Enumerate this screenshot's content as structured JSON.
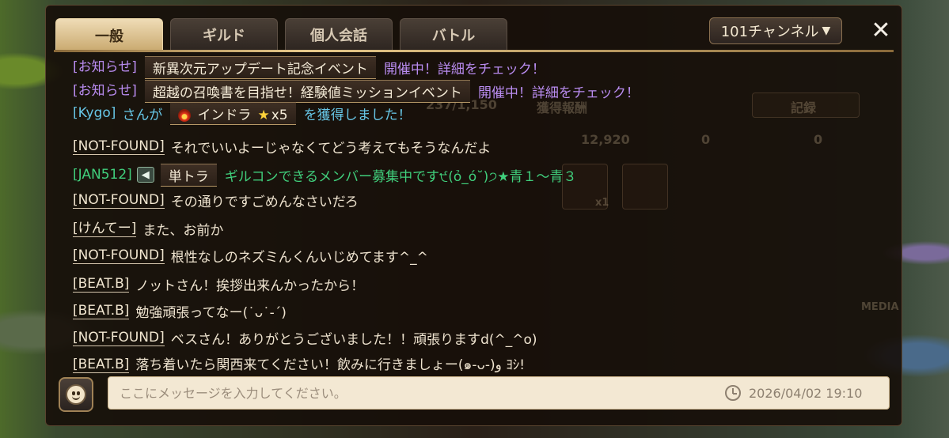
{
  "tabs": [
    {
      "label": "一般",
      "active": true
    },
    {
      "label": "ギルド",
      "active": false
    },
    {
      "label": "個人会話",
      "active": false
    },
    {
      "label": "バトル",
      "active": false
    }
  ],
  "channel": {
    "label": "101チャンネル",
    "arrow": "▼"
  },
  "close": {
    "glyph": "✕"
  },
  "background_ui": {
    "count": "237/1,150",
    "reward_title": "獲得報酬",
    "record_button": "記録",
    "resource_1": "12,920",
    "resource_2": "0",
    "resource_3": "0",
    "item_count": "x1",
    "side_label": "MEDIA"
  },
  "messages": [
    {
      "sender": "[お知らせ]",
      "tag": "新異次元アップデート記念イベント",
      "text": "開催中！詳細をチェック！"
    },
    {
      "sender": "[お知らせ]",
      "tag": "超越の召喚書を目指せ！経験値ミッションイベント",
      "text": "開催中！詳細をチェック！"
    },
    {
      "sender": "[Kygo]",
      "pre": "さんが",
      "tag_name": "インドラ",
      "tag_count": "x5",
      "text": "を獲得しました！"
    },
    {
      "sender": "[NOT-FOUND]",
      "text": "それでいいよーじゃなくてどう考えてもそうなんだよ"
    },
    {
      "sender": "[JAN512]",
      "tag": "単トラ",
      "text": "ギルコンできるメンバー募集中です੯(ỏ_ó˘)੭★青１〜青３"
    },
    {
      "sender": "[NOT-FOUND]",
      "text": "その通りですごめんなさいだろ"
    },
    {
      "sender": "[けんてー]",
      "text": "また、お前か"
    },
    {
      "sender": "[NOT-FOUND]",
      "text": "根性なしのネズミんくんいじめてます^_^"
    },
    {
      "sender": "[BEAT.B]",
      "text": "ノットさん！挨拶出来んかったから！"
    },
    {
      "sender": "[BEAT.B]",
      "text": "勉強頑張ってなー(˙ᴗ˙-ˊ)"
    },
    {
      "sender": "[NOT-FOUND]",
      "text": "ベスさん！ありがとうございました！！頑張りますd(^_^o)"
    },
    {
      "sender": "[BEAT.B]",
      "text": "落ち着いたら関西来てください！飲みに行きましょー(๑-ᴗ-)و ﾖｼ!"
    }
  ],
  "input": {
    "placeholder": "ここにメッセージを入力してください。"
  },
  "timestamp": "2026/04/02  19:10",
  "colors": {
    "notice": "#b98cf0",
    "system": "#67c6e6",
    "megaphone": "#40cf7c",
    "accent": "#e7d3a6"
  }
}
